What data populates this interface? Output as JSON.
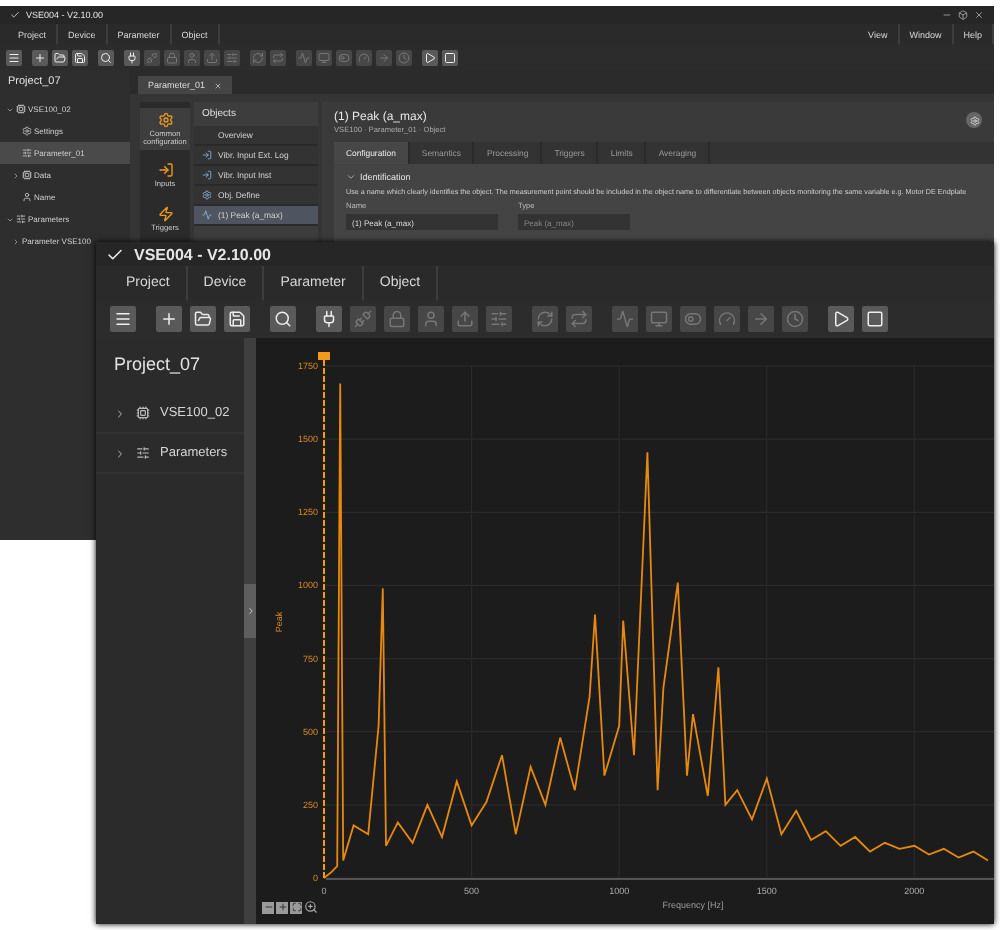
{
  "back_window": {
    "title": "VSE004 - V2.10.00",
    "menu": [
      "Project",
      "Device",
      "Parameter",
      "Object"
    ],
    "menu_right": [
      "View",
      "Window",
      "Help"
    ],
    "toolbar": [
      {
        "kind": "menu",
        "disabled": false
      },
      {
        "kind": "add",
        "disabled": false
      },
      {
        "kind": "open",
        "disabled": false
      },
      {
        "kind": "save",
        "disabled": false
      },
      {
        "kind": "search",
        "disabled": false
      },
      {
        "kind": "connect",
        "disabled": false
      },
      {
        "kind": "disconnect",
        "disabled": true
      },
      {
        "kind": "lock",
        "disabled": true
      },
      {
        "kind": "user",
        "disabled": true
      },
      {
        "kind": "upload",
        "disabled": true
      },
      {
        "kind": "sliders",
        "disabled": true
      },
      {
        "kind": "refresh",
        "disabled": true
      },
      {
        "kind": "sync",
        "disabled": true
      },
      {
        "kind": "pulse",
        "disabled": true
      },
      {
        "kind": "monitor",
        "disabled": true
      },
      {
        "kind": "toggle",
        "disabled": true
      },
      {
        "kind": "gauge",
        "disabled": true
      },
      {
        "kind": "arrow",
        "disabled": true
      },
      {
        "kind": "clock",
        "disabled": true
      },
      {
        "kind": "play",
        "disabled": false
      },
      {
        "kind": "stop",
        "disabled": false
      }
    ],
    "sidebar": {
      "title": "Project_07",
      "items": [
        {
          "label": "VSE100_02",
          "kind": "device",
          "expanded": true,
          "children": [
            {
              "label": "Settings",
              "kind": "settings",
              "selected": false
            },
            {
              "label": "Parameter_01",
              "kind": "parameters",
              "selected": true
            },
            {
              "label": "Data",
              "kind": "device",
              "expanded": false,
              "selected": false
            },
            {
              "label": "Name",
              "kind": "user",
              "selected": false
            }
          ]
        },
        {
          "label": "Parameters",
          "kind": "parameters",
          "expanded": true,
          "children": [
            {
              "label": "Parameter VSE100",
              "kind": "none",
              "expanded": false,
              "selected": false
            }
          ]
        }
      ]
    },
    "tab": {
      "label": "Parameter_01"
    },
    "categories": [
      {
        "label": "Common configuration",
        "kind": "settings",
        "selected": true
      },
      {
        "label": "Inputs",
        "kind": "input",
        "selected": false
      },
      {
        "label": "Triggers",
        "kind": "trigger",
        "selected": false
      }
    ],
    "objects": {
      "title": "Objects",
      "items": [
        {
          "label": "Overview",
          "kind": "none",
          "selected": false
        },
        {
          "label": "Vibr. Input Ext. Log",
          "kind": "input",
          "selected": false
        },
        {
          "label": "Vibr. Input Inst",
          "kind": "input",
          "selected": false
        },
        {
          "label": "Obj. Define",
          "kind": "settings",
          "selected": false
        },
        {
          "label": "(1) Peak (a_max)",
          "kind": "peak",
          "selected": true
        }
      ]
    },
    "detail": {
      "title": "(1) Peak (a_max)",
      "subtitle": "VSE100 · Parameter_01 · Object",
      "tabs": [
        {
          "label": "Configuration",
          "selected": true
        },
        {
          "label": "Semantics",
          "selected": false
        },
        {
          "label": "Processing",
          "selected": false
        },
        {
          "label": "Triggers",
          "selected": false
        },
        {
          "label": "Limits",
          "selected": false
        },
        {
          "label": "Averaging",
          "selected": false
        }
      ],
      "section": {
        "label": "Identification",
        "expanded": true
      },
      "description": "Use a name which clearly identifies the object. The measurement point should be included in the object name to differentiate between objects monitoring the same variable e.g. Motor DE Endplate",
      "name_label": "Name",
      "name_value": "(1) Peak (a_max)",
      "type_label": "Type",
      "type_value": "Peak (a_max)"
    }
  },
  "front_window": {
    "title": "VSE004 - V2.10.00",
    "menu": [
      "Project",
      "Device",
      "Parameter",
      "Object"
    ],
    "toolbar": [
      {
        "kind": "menu",
        "disabled": false
      },
      {
        "kind": "add",
        "disabled": false
      },
      {
        "kind": "open",
        "disabled": false
      },
      {
        "kind": "save",
        "disabled": false
      },
      {
        "kind": "search",
        "disabled": false
      },
      {
        "kind": "connect",
        "disabled": false
      },
      {
        "kind": "disconnect",
        "disabled": true
      },
      {
        "kind": "lock",
        "disabled": true
      },
      {
        "kind": "user",
        "disabled": true
      },
      {
        "kind": "upload",
        "disabled": true
      },
      {
        "kind": "sliders",
        "disabled": true
      },
      {
        "kind": "refresh",
        "disabled": true
      },
      {
        "kind": "sync",
        "disabled": true
      },
      {
        "kind": "pulse",
        "disabled": true
      },
      {
        "kind": "monitor",
        "disabled": true
      },
      {
        "kind": "toggle",
        "disabled": true
      },
      {
        "kind": "gauge",
        "disabled": true
      },
      {
        "kind": "arrow",
        "disabled": true
      },
      {
        "kind": "clock",
        "disabled": true
      },
      {
        "kind": "play",
        "disabled": false
      },
      {
        "kind": "stop",
        "disabled": false
      }
    ],
    "sidebar": {
      "title": "Project_07",
      "items": [
        {
          "label": "VSE100_02",
          "kind": "device",
          "expanded": false
        },
        {
          "label": "Parameters",
          "kind": "parameters",
          "expanded": false
        }
      ]
    },
    "chart": {
      "chart_data": {
        "type": "line",
        "xlabel": "Frequency [Hz]",
        "ylabel": "Peak",
        "x": [
          0,
          25,
          45,
          55,
          65,
          100,
          150,
          185,
          199,
          210,
          250,
          300,
          350,
          400,
          450,
          500,
          550,
          603,
          650,
          700,
          750,
          800,
          850,
          900,
          918,
          950,
          1000,
          1014,
          1050,
          1096,
          1130,
          1150,
          1199,
          1230,
          1250,
          1300,
          1336,
          1360,
          1400,
          1450,
          1500,
          1550,
          1600,
          1650,
          1700,
          1750,
          1800,
          1850,
          1900,
          1950,
          2000,
          2050,
          2100,
          2150,
          2200,
          2250
        ],
        "series": [
          {
            "color": "#e8890f",
            "values": [
              0,
              20,
              40,
              1690,
              60,
              180,
              150,
              520,
              990,
              110,
              190,
              120,
              250,
              140,
              330,
              180,
              260,
              420,
              150,
              380,
              250,
              480,
              300,
              620,
              900,
              350,
              520,
              880,
              420,
              1455,
              300,
              650,
              1010,
              350,
              560,
              280,
              720,
              250,
              300,
              200,
              340,
              150,
              230,
              130,
              160,
              110,
              140,
              90,
              120,
              100,
              110,
              80,
              100,
              70,
              90,
              60
            ]
          }
        ],
        "grid": true,
        "xlim": [
          0,
          2270
        ],
        "ylim": [
          0,
          1750
        ],
        "xticks": [
          0,
          500,
          1000,
          1500,
          2000
        ],
        "yticks": [
          0,
          250,
          500,
          750,
          1000,
          1250,
          1500,
          1750
        ]
      }
    }
  }
}
